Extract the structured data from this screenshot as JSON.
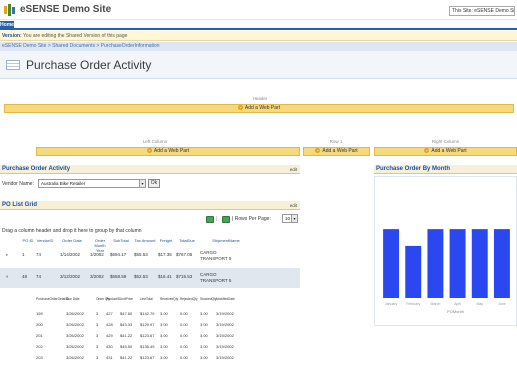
{
  "site": {
    "title": "eSENSE Demo Site",
    "search_scope": "This Site: eSENSE Demo Site"
  },
  "nav": {
    "home_tab": "Home"
  },
  "version_bar": {
    "label": "Version:",
    "text": "You are editing the Shared Version of this page"
  },
  "breadcrumb": "eSENSE Demo Site > Shared Documents > PurchaseOrderInformation",
  "page": {
    "title": "Purchase Order Activity"
  },
  "zones": {
    "header": "Header",
    "left": "Left Column",
    "row1": "Row 1",
    "right": "Right Column",
    "add_web_part": "Add a Web Part"
  },
  "po_activity": {
    "title": "Purchase Order Activity",
    "edit": "edit",
    "vendor_label": "Vendor Name:",
    "vendor_value": "Australia Bike Retailer",
    "ok": "Ok"
  },
  "po_grid": {
    "title": "PO List Grid",
    "edit": "edit",
    "rows_per_page_label": "Rows Per Page:",
    "rows_per_page": "10",
    "group_hint": "Drag a column header and drop it here to group by that column",
    "columns": [
      "PO ID",
      "VendorID",
      "Order Date",
      "Order Month Year",
      "SubTotal",
      "Tax Amount",
      "Freight",
      "TotalDue",
      "ShipmentName"
    ],
    "rows": [
      [
        "1",
        "74",
        "1/14/2002",
        "1/2002",
        "$694.17",
        "$55.53",
        "$17.35",
        "$767.05",
        "CARGO TRANSPORT 5"
      ],
      [
        "48",
        "74",
        "3/12/2002",
        "3/2002",
        "$658.59",
        "$52.53",
        "$16.41",
        "$715.53",
        "CARGO TRANSPORT 5"
      ]
    ],
    "detail_columns": [
      "PurchaseOrderDetailID",
      "Due Date",
      "Order Qty",
      "ProductID",
      "UnitPrice",
      "LineTotal",
      "ReceivedQty",
      "RejectedQty",
      "StockedQty",
      "ModifiedDate"
    ],
    "detail_rows": [
      [
        "199",
        "3/26/2002",
        "3",
        "427",
        "$47.60",
        "$142.79",
        "3.00",
        "0.00",
        "3.00",
        "3/19/2002"
      ],
      [
        "200",
        "3/26/2002",
        "3",
        "428",
        "$43.33",
        "$129.97",
        "3.00",
        "0.00",
        "3.00",
        "3/19/2002"
      ],
      [
        "201",
        "3/26/2002",
        "3",
        "429",
        "$41.22",
        "$123.67",
        "3.00",
        "0.00",
        "3.00",
        "3/19/2002"
      ],
      [
        "202",
        "3/26/2002",
        "3",
        "430",
        "$45.50",
        "$136.49",
        "3.00",
        "0.00",
        "3.00",
        "3/19/2002"
      ],
      [
        "203",
        "3/26/2002",
        "3",
        "431",
        "$41.22",
        "$123.67",
        "3.00",
        "0.00",
        "3.00",
        "3/19/2002"
      ]
    ]
  },
  "chart_panel": {
    "title": "Purchase Order By Month"
  },
  "chart_data": {
    "type": "bar",
    "title": "Purchase Order By Month",
    "categories": [
      "January",
      "February",
      "March",
      "April",
      "May",
      "June"
    ],
    "values": [
      0.82,
      0.62,
      0.82,
      0.82,
      0.82,
      0.82
    ],
    "xlabel": "POMonth",
    "ylabel": "",
    "ylim": [
      0,
      1
    ],
    "color": "#2b48f0"
  }
}
